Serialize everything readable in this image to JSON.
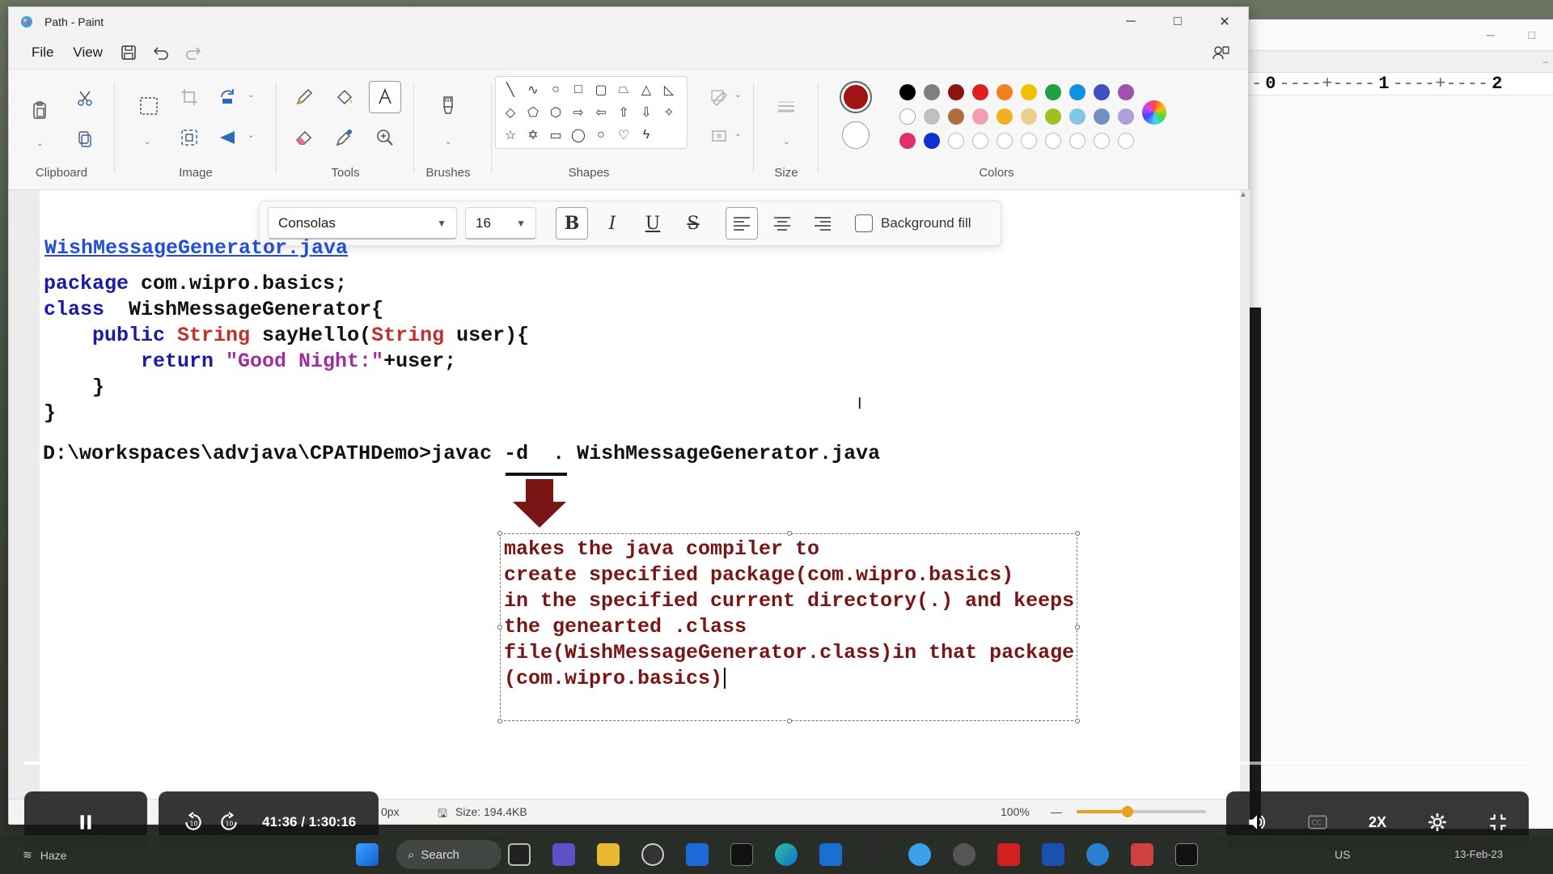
{
  "window": {
    "title": "Path - Paint",
    "controls": {
      "minimize": "─",
      "maximize": "□",
      "close": "✕"
    }
  },
  "menu": {
    "file": "File",
    "view": "View"
  },
  "ribbon": {
    "groups": {
      "clipboard": "Clipboard",
      "image": "Image",
      "tools": "Tools",
      "brushes": "Brushes",
      "shapes": "Shapes",
      "size": "Size",
      "colors": "Colors"
    },
    "primary_color": "#a01414",
    "secondary_color": "#ffffff",
    "palette_row1": [
      "#000000",
      "#7f7f7f",
      "#8b1414",
      "#e02020",
      "#f08020",
      "#f0c000",
      "#20a040",
      "#1090e0",
      "#4050c0",
      "#a050b0"
    ],
    "palette_row2": [
      "#ffffff",
      "#c0c0c0",
      "#b06e40",
      "#f0a0b0",
      "#f0b020",
      "#e8d090",
      "#a0c020",
      "#80c8e0",
      "#7090c0",
      "#b0a0d8"
    ],
    "palette_row3": [
      "#e0306a",
      "#1030d0"
    ]
  },
  "text_toolbar": {
    "font": "Consolas",
    "size": "16",
    "bold": "B",
    "italic": "I",
    "underline": "U",
    "strike": "S",
    "background_fill": "Background fill"
  },
  "canvas": {
    "filename": "WishMessageGenerator.java",
    "code_line1_kw": "package",
    "code_line1_rest": " com.wipro.basics;",
    "code_line2_kw": "class",
    "code_line2_rest": "  WishMessageGenerator{",
    "code_line3_kw": "public",
    "code_line3_type": "String",
    "code_line3_mid": " sayHello(",
    "code_line3_type2": "String",
    "code_line3_end": " user){",
    "code_line4_kw": "return",
    "code_line4_str": "\"Good Night:\"",
    "code_line4_end": "+user;",
    "code_line5": "}",
    "code_line6": "}",
    "command": "D:\\workspaces\\advjava\\CPATHDemo>javac -d  . WishMessageGenerator.java",
    "note_lines": [
      "makes the java compiler to",
      "create specified package(com.wipro.basics)",
      "in the specified current directory(.) and keeps",
      "the genearted .class",
      "file(WishMessageGenerator.class)in that package",
      "(com.wipro.basics)"
    ]
  },
  "statusbar": {
    "dimension": "0px",
    "size": "Size: 194.4KB",
    "zoom": "100%"
  },
  "video": {
    "time": "41:36 / 1:30:16",
    "speed": "2X",
    "progress": 0.46
  },
  "background_window": {
    "ruler_marks": [
      "0",
      "1",
      "2"
    ]
  },
  "taskbar": {
    "weather": "Haze",
    "search": "Search",
    "lang": "US",
    "date": "13-Feb-23"
  }
}
